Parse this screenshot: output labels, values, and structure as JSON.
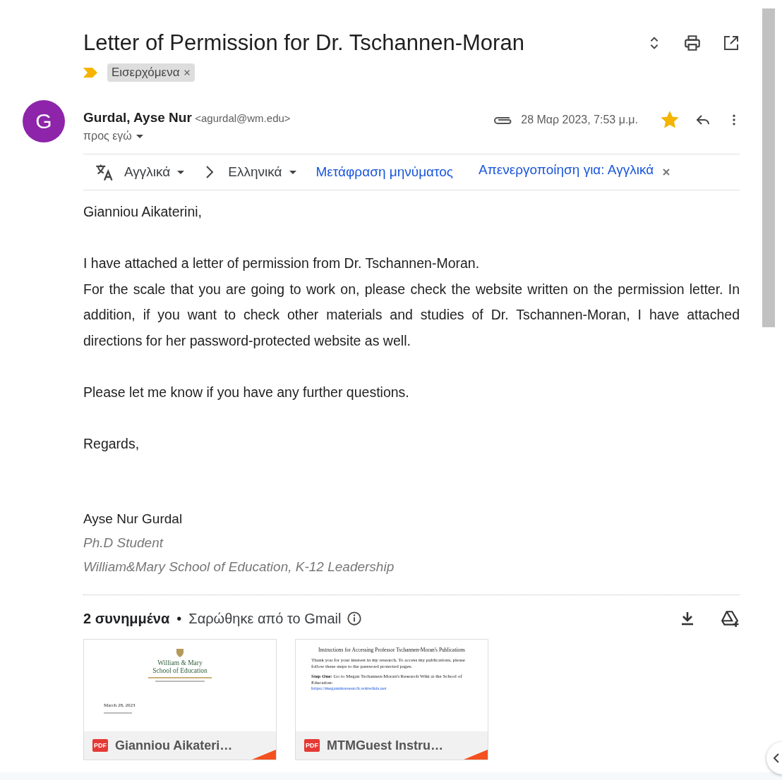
{
  "email": {
    "subject": "Letter of Permission for Dr. Tschannen-Moran",
    "important": true,
    "labels": [
      {
        "text": "Εισερχόμενα"
      }
    ],
    "sender": {
      "initial": "G",
      "name": "Gurdal, Ayse Nur",
      "address": "<agurdal@wm.edu>",
      "recipient": "προς εγώ",
      "date": "28 Μαρ 2023, 7:53 μ.μ.",
      "starred": true
    },
    "translation": {
      "source": "Αγγλικά",
      "target": "Ελληνικά",
      "translate_link": "Μετάφραση μηνύματος",
      "disable_link": "Απενεργοποίηση για: Αγγλικά"
    },
    "paragraphs": [
      {
        "lines": [
          "Gianniou Aikaterini,"
        ]
      },
      {
        "lines": [
          "I have attached a letter of permission from Dr. Tschannen-Moran.",
          "For the scale that you are going to work on, please check the website written on the permission letter. In addition, if you want to check other materials and studies of Dr. Tschannen-Moran, I have attached directions for her password-protected website as well."
        ]
      },
      {
        "lines": [
          "Please let me know if you have any further questions."
        ]
      },
      {
        "lines": [
          "Regards,"
        ]
      }
    ],
    "signature": {
      "name": "Ayse Nur Gurdal",
      "lines": [
        "Ph.D Student",
        "William&Mary School of Education, K-12 Leadership"
      ]
    },
    "attachments": {
      "count": "2 συνημμένα",
      "separator": "•",
      "scan_note": "Σαρώθηκε από το Gmail",
      "files": [
        {
          "name": "Gianniou Aikateri…",
          "badge": "PDF",
          "preview": {
            "kind": "letter",
            "heading": [
              "William & Mary",
              "School of Education"
            ],
            "date": "March 28, 2023"
          }
        },
        {
          "name": "MTMGuest Instru…",
          "badge": "PDF",
          "preview": {
            "kind": "instructions",
            "title": "Instructions for Accessing Professor Tschannen-Moran's Publications",
            "paragraphs": [
              "Thank you for your interest in my research. To access my publications, please follow these steps to the password protected pages.",
              "**Step One:** Go to Megan Tschannen-Moran's Research Wiki at the School of Education:"
            ],
            "link": "https://megantmresearch.wmwikis.net"
          }
        }
      ]
    }
  }
}
